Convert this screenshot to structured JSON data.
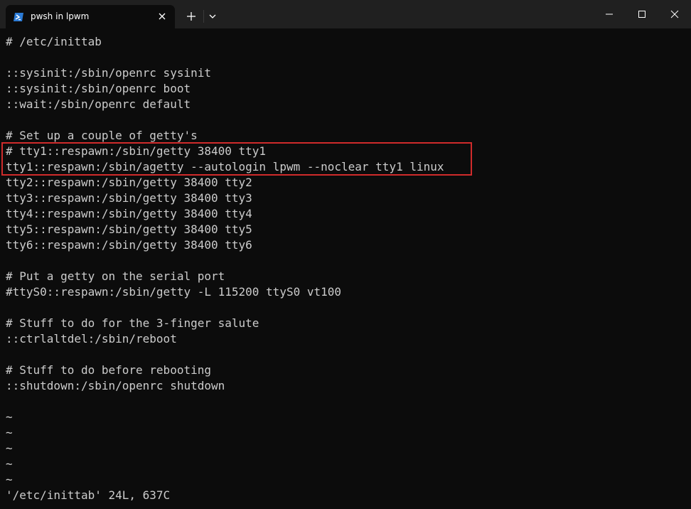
{
  "window": {
    "tab_title": "pwsh in lpwm",
    "tab_icon": "powershell-icon",
    "new_tab_icon": "plus-icon",
    "dropdown_icon": "chevron-down-icon",
    "controls": [
      "minimize-icon",
      "maximize-icon",
      "close-icon"
    ]
  },
  "terminal": {
    "lines": [
      "# /etc/inittab",
      "",
      "::sysinit:/sbin/openrc sysinit",
      "::sysinit:/sbin/openrc boot",
      "::wait:/sbin/openrc default",
      "",
      "# Set up a couple of getty's",
      "# tty1::respawn:/sbin/getty 38400 tty1",
      "tty1::respawn:/sbin/agetty --autologin lpwm --noclear tty1 linux",
      "tty2::respawn:/sbin/getty 38400 tty2",
      "tty3::respawn:/sbin/getty 38400 tty3",
      "tty4::respawn:/sbin/getty 38400 tty4",
      "tty5::respawn:/sbin/getty 38400 tty5",
      "tty6::respawn:/sbin/getty 38400 tty6",
      "",
      "# Put a getty on the serial port",
      "#ttyS0::respawn:/sbin/getty -L 115200 ttyS0 vt100",
      "",
      "# Stuff to do for the 3-finger salute",
      "::ctrlaltdel:/sbin/reboot",
      "",
      "# Stuff to do before rebooting",
      "::shutdown:/sbin/openrc shutdown",
      "",
      "~",
      "~",
      "~",
      "~",
      "~"
    ],
    "status_line": "'/etc/inittab' 24L, 637C",
    "highlight_color": "#d02b2b",
    "text_color": "#cccccc",
    "background_color": "#0c0c0c"
  }
}
